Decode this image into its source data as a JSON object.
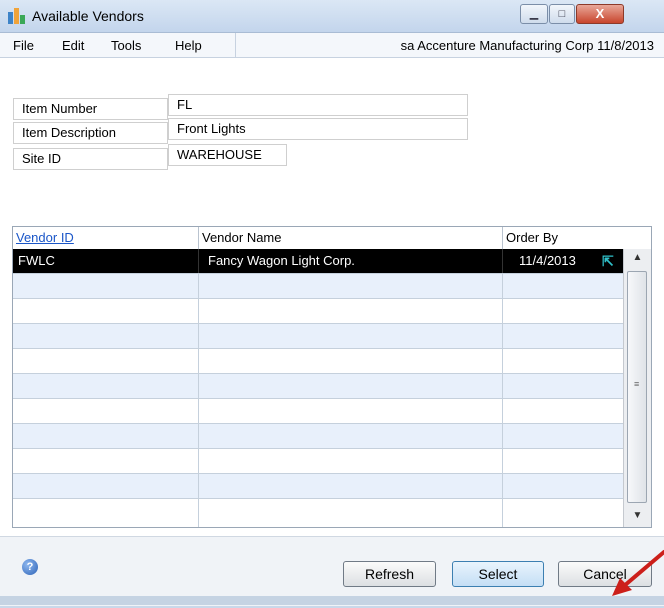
{
  "window": {
    "title": "Available Vendors",
    "min_symbol": "▁",
    "max_symbol": "□",
    "close_symbol": "X"
  },
  "menu": {
    "items": [
      "File",
      "Edit",
      "Tools",
      "Help"
    ],
    "status": "sa  Accenture Manufacturing Corp  11/8/2013"
  },
  "fields": [
    {
      "label": "Item Number",
      "value": "FL"
    },
    {
      "label": "Item Description",
      "value": "Front Lights"
    },
    {
      "label": "Site ID",
      "value": "WAREHOUSE"
    }
  ],
  "grid": {
    "columns": [
      "Vendor ID",
      "Vendor Name",
      "Order By"
    ],
    "rows": [
      {
        "vendor_id": "FWLC",
        "vendor_name": "Fancy Wagon Light Corp.",
        "order_by": "11/4/2013"
      }
    ]
  },
  "buttons": {
    "refresh": "Refresh",
    "select": "Select",
    "cancel": "Cancel"
  },
  "colors": {
    "selected_row": "#000000",
    "alt_row": "#e8f0fb",
    "link": "#1a56c8",
    "annotation_arrow": "#cc1f1a"
  }
}
